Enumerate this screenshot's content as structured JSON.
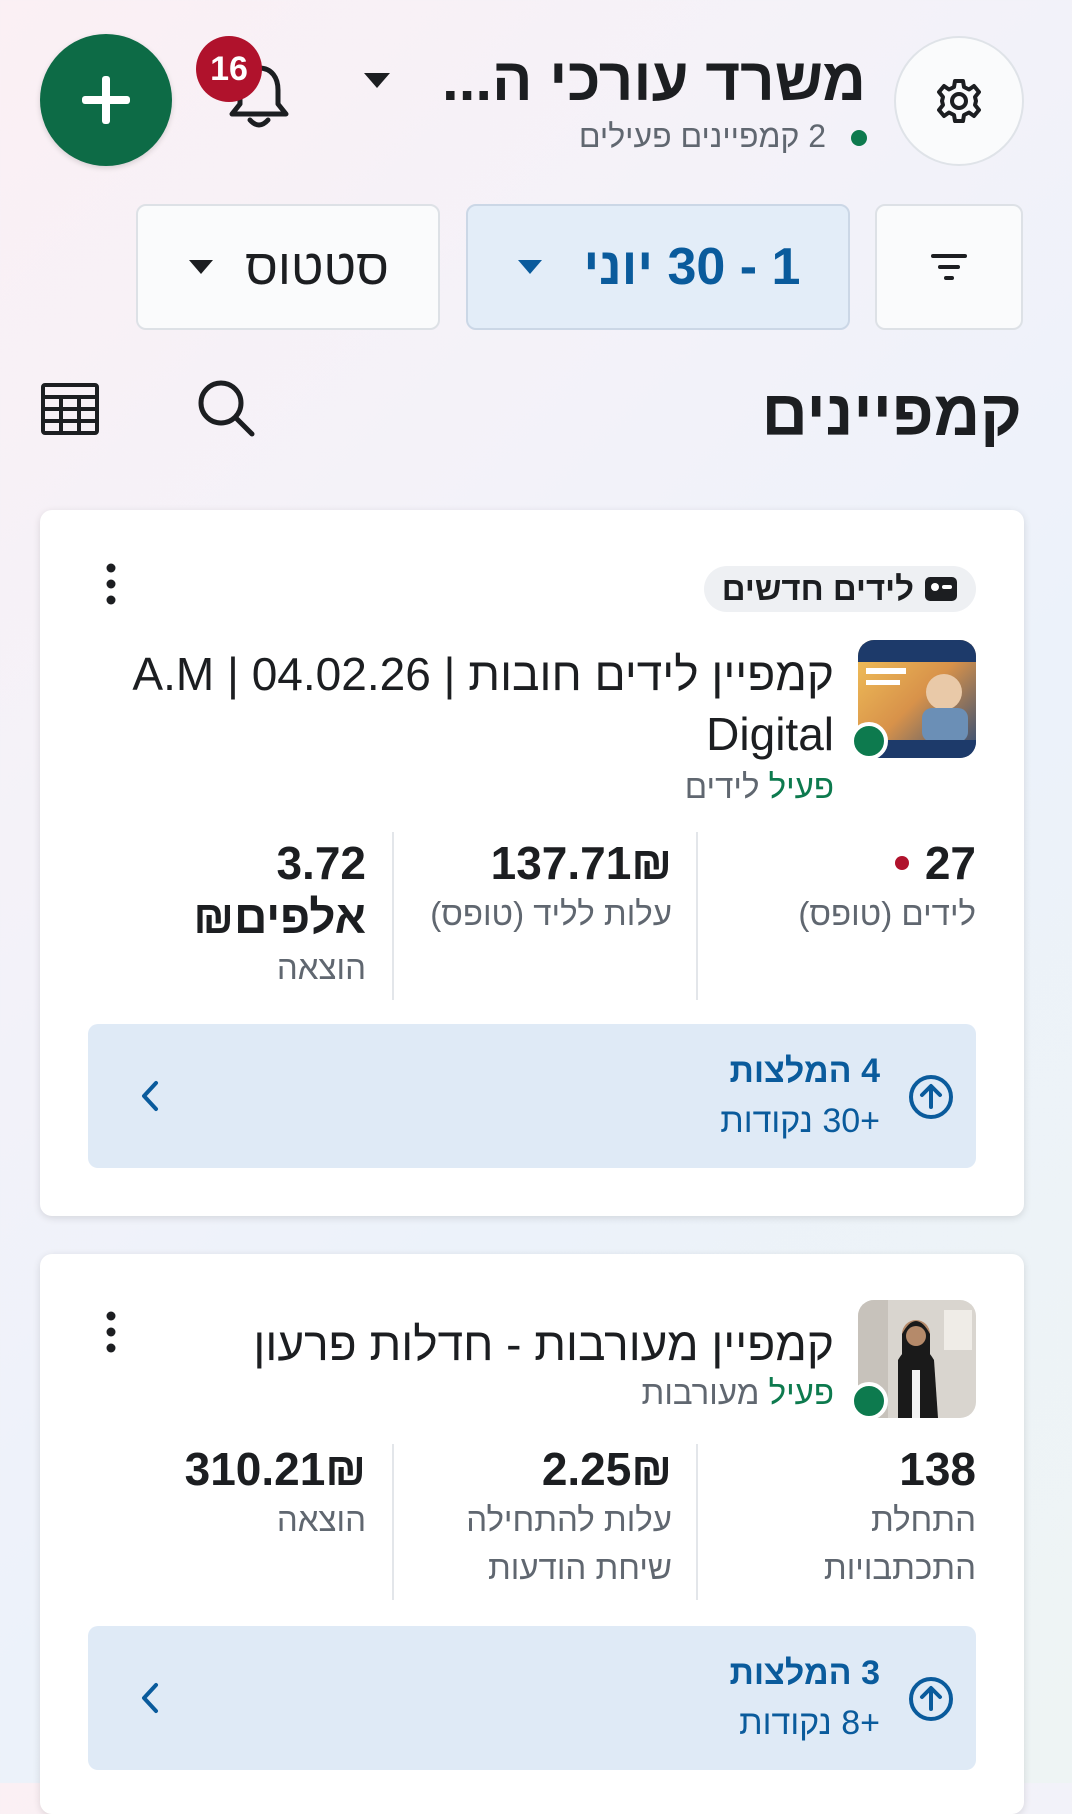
{
  "header": {
    "account_title": "משרד עורכי ה...",
    "active_campaigns": "2 קמפיינים פעילים",
    "notification_count": "16"
  },
  "filters": {
    "status_label": "סטטוס",
    "date_range": "1 - 30 יוני"
  },
  "section": {
    "title": "קמפיינים"
  },
  "campaigns": [
    {
      "tag": "לידים חדשים",
      "name": "קמפיין לידים חובות | 04.02.26 | A.M Digital",
      "status": "פעיל",
      "objective": "לידים",
      "metrics": [
        {
          "value": "27",
          "label": "לידים (טופס)"
        },
        {
          "value": "137.71₪",
          "label": "עלות לליד (טופס)"
        },
        {
          "value": "3.72 אלפים₪",
          "label": "הוצאה"
        }
      ],
      "recommendations": {
        "title": "4 המלצות",
        "points": "+30 נקודות"
      }
    },
    {
      "name": "קמפיין מעורבות - חדלות פרעון",
      "status": "פעיל",
      "objective": "מעורבות",
      "metrics": [
        {
          "value": "138",
          "label": "התחלת התכתבויות"
        },
        {
          "value": "2.25₪",
          "label": "עלות להתחילה שיחת הודעות"
        },
        {
          "value": "310.21₪",
          "label": "הוצאה"
        }
      ],
      "recommendations": {
        "title": "3 המלצות",
        "points": "+8 נקודות"
      }
    }
  ],
  "colors": {
    "brand_green": "#0d6b46",
    "accent_blue": "#0a5b9c",
    "badge_red": "#b0122c",
    "recommendation_bg": "#dfeaf6"
  }
}
